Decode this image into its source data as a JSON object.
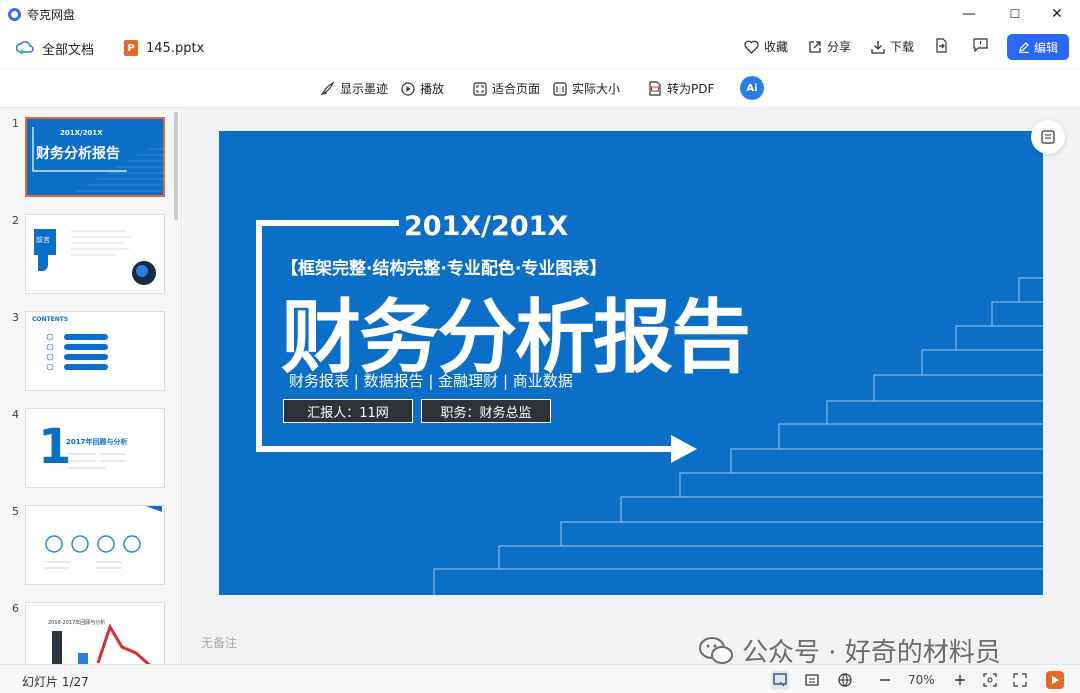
{
  "app": {
    "title": "夸克网盘"
  },
  "window": {
    "min": "—",
    "max": "☐",
    "close": "✕"
  },
  "nav": {
    "all_docs": "全部文档",
    "filename": "145.pptx",
    "file_badge": "P"
  },
  "actions": {
    "favorite": "收藏",
    "share": "分享",
    "download": "下载",
    "edit": "编辑"
  },
  "toolbar": {
    "show_ink": "显示墨迹",
    "play": "播放",
    "fit_page": "适合页面",
    "actual_size": "实际大小",
    "to_pdf": "转为PDF",
    "ai": "Ai"
  },
  "thumbnails": [
    "1",
    "2",
    "3",
    "4",
    "5",
    "6"
  ],
  "thumb_text": {
    "t1_year": "201X/201X",
    "t1_title": "财务分析报告",
    "t2_title": "前言",
    "t3_title": "CONTENTS",
    "t3_items": [
      "2017年回顾与分析",
      "",
      "工作不足与总结",
      "2018年规划"
    ],
    "t4_title": "2017年回顾与分析",
    "t4_num": "1",
    "t6_sub": "2016-2017年回顾与分析"
  },
  "slide": {
    "year": "201X/201X",
    "tagline": "【框架完整·结构完整·专业配色·专业图表】",
    "title": "财务分析报告",
    "subtitle": "财务报表 | 数据报告 | 金融理财 | 商业数据",
    "reporter": "汇报人：11网",
    "position": "职务：财务总监"
  },
  "notes_placeholder": "无备注",
  "watermark": "公众号 · 好奇的材料员",
  "status": {
    "slide_counter": "幻灯片 1/27",
    "zoom": "70%"
  },
  "colors": {
    "accent": "#2a67f5",
    "slide_bg": "#0b6ec7",
    "ppt_orange": "#e5682b"
  }
}
